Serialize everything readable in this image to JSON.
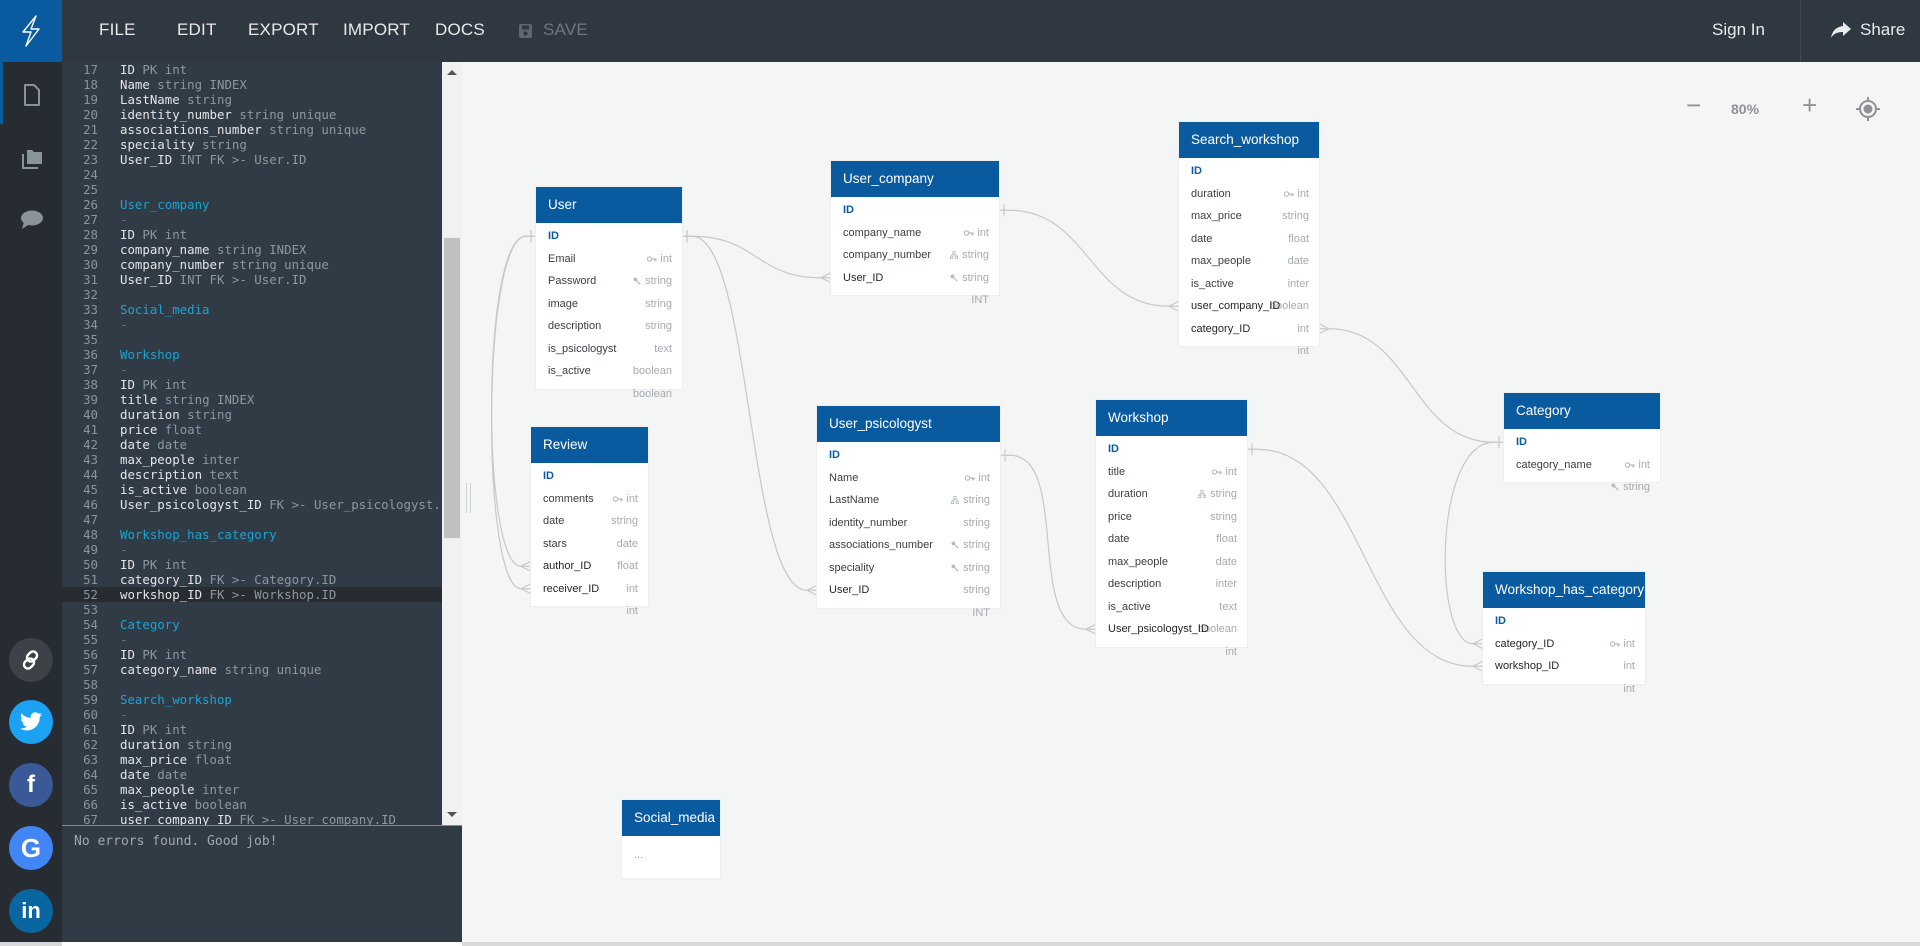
{
  "nav": {
    "menu": [
      "FILE",
      "EDIT",
      "EXPORT",
      "IMPORT",
      "DOCS"
    ],
    "save_label": "SAVE",
    "sign_in": "Sign In",
    "share": "Share"
  },
  "rail": {
    "icons": [
      "document-icon",
      "folders-icon",
      "chat-icon"
    ],
    "social": [
      {
        "name": "link",
        "color": "#3d4248"
      },
      {
        "name": "twitter",
        "color": "#1da1f2"
      },
      {
        "name": "facebook",
        "color": "#3b5998"
      },
      {
        "name": "google",
        "color": "#4285f4"
      },
      {
        "name": "linkedin",
        "color": "#0a66a0"
      }
    ]
  },
  "editor": {
    "active_line": 52,
    "lines": [
      {
        "n": 17,
        "name": "ID",
        "rest": " PK int"
      },
      {
        "n": 18,
        "name": "Name",
        "rest": " string INDEX"
      },
      {
        "n": 19,
        "name": "LastName",
        "rest": " string"
      },
      {
        "n": 20,
        "name": "identity_number",
        "rest": " string unique"
      },
      {
        "n": 21,
        "name": "associations_number",
        "rest": " string unique"
      },
      {
        "n": 22,
        "name": "speciality",
        "rest": " string"
      },
      {
        "n": 23,
        "name": "User_ID",
        "rest": " INT FK >- User.ID"
      },
      {
        "n": 24
      },
      {
        "n": 25
      },
      {
        "n": 26,
        "table": "User_company"
      },
      {
        "n": 27,
        "dash": "-"
      },
      {
        "n": 28,
        "name": "ID",
        "rest": " PK int"
      },
      {
        "n": 29,
        "name": "company_name",
        "rest": " string INDEX"
      },
      {
        "n": 30,
        "name": "company_number",
        "rest": " string unique"
      },
      {
        "n": 31,
        "name": "User_ID",
        "rest": " INT FK >- User.ID"
      },
      {
        "n": 32
      },
      {
        "n": 33,
        "table": "Social_media"
      },
      {
        "n": 34,
        "dash": "-"
      },
      {
        "n": 35
      },
      {
        "n": 36,
        "table": "Workshop"
      },
      {
        "n": 37,
        "dash": "-"
      },
      {
        "n": 38,
        "name": "ID",
        "rest": " PK int"
      },
      {
        "n": 39,
        "name": "title",
        "rest": " string INDEX"
      },
      {
        "n": 40,
        "name": "duration",
        "rest": " string"
      },
      {
        "n": 41,
        "name": "price",
        "rest": " float"
      },
      {
        "n": 42,
        "name": "date",
        "rest": " date"
      },
      {
        "n": 43,
        "name": "max_people",
        "rest": " inter"
      },
      {
        "n": 44,
        "name": "description",
        "rest": " text"
      },
      {
        "n": 45,
        "name": "is_active",
        "rest": " boolean"
      },
      {
        "n": 46,
        "name": "User_psicologyst_ID",
        "rest": " FK >- User_psicologyst.ID"
      },
      {
        "n": 47
      },
      {
        "n": 48,
        "table": "Workshop_has_category"
      },
      {
        "n": 49,
        "dash": "-"
      },
      {
        "n": 50,
        "name": "ID",
        "rest": " PK int"
      },
      {
        "n": 51,
        "name": "category_ID",
        "rest": " FK >- Category.ID"
      },
      {
        "n": 52,
        "name": "workshop_ID",
        "rest": " FK >- Workshop.ID"
      },
      {
        "n": 53
      },
      {
        "n": 54,
        "table": "Category"
      },
      {
        "n": 55,
        "dash": "-"
      },
      {
        "n": 56,
        "name": "ID",
        "rest": " PK int"
      },
      {
        "n": 57,
        "name": "category_name",
        "rest": " string unique"
      },
      {
        "n": 58
      },
      {
        "n": 59,
        "table": "Search_workshop"
      },
      {
        "n": 60,
        "dash": "-"
      },
      {
        "n": 61,
        "name": "ID",
        "rest": " PK int"
      },
      {
        "n": 62,
        "name": "duration",
        "rest": " string"
      },
      {
        "n": 63,
        "name": "max_price",
        "rest": " float"
      },
      {
        "n": 64,
        "name": "date",
        "rest": " date"
      },
      {
        "n": 65,
        "name": "max_people",
        "rest": " inter"
      },
      {
        "n": 66,
        "name": "is_active",
        "rest": " boolean"
      },
      {
        "n": 67,
        "name": "user_company_ID",
        "rest": " FK >- User_company.ID"
      }
    ],
    "status": "No errors found. Good job!"
  },
  "canvas": {
    "zoom_level": "80%",
    "tables": [
      {
        "id": "User",
        "title": "User",
        "fields": [
          {
            "name": "ID",
            "type": "int",
            "kind": "pk",
            "icon": "key"
          },
          {
            "name": "Email",
            "type": "string",
            "icon": "unique"
          },
          {
            "name": "Password",
            "type": "string"
          },
          {
            "name": "image",
            "type": "string"
          },
          {
            "name": "description",
            "type": "text"
          },
          {
            "name": "is_psicologyst",
            "type": "boolean"
          },
          {
            "name": "is_active",
            "type": "boolean"
          }
        ]
      },
      {
        "id": "User_company",
        "title": "User_company",
        "fields": [
          {
            "name": "ID",
            "type": "int",
            "kind": "pk",
            "icon": "key"
          },
          {
            "name": "company_name",
            "type": "string",
            "icon": "index"
          },
          {
            "name": "company_number",
            "type": "string",
            "icon": "unique"
          },
          {
            "name": "User_ID",
            "type": "INT",
            "kind": "fk"
          }
        ]
      },
      {
        "id": "Search_workshop",
        "title": "Search_workshop",
        "fields": [
          {
            "name": "ID",
            "type": "int",
            "kind": "pk",
            "icon": "key"
          },
          {
            "name": "duration",
            "type": "string"
          },
          {
            "name": "max_price",
            "type": "float"
          },
          {
            "name": "date",
            "type": "date"
          },
          {
            "name": "max_people",
            "type": "inter"
          },
          {
            "name": "is_active",
            "type": "boolean"
          },
          {
            "name": "user_company_ID",
            "type": "int",
            "kind": "fk"
          },
          {
            "name": "category_ID",
            "type": "int",
            "kind": "fk"
          }
        ]
      },
      {
        "id": "Review",
        "title": "Review",
        "fields": [
          {
            "name": "ID",
            "type": "int",
            "kind": "pk",
            "icon": "key"
          },
          {
            "name": "comments",
            "type": "string"
          },
          {
            "name": "date",
            "type": "date"
          },
          {
            "name": "stars",
            "type": "float"
          },
          {
            "name": "author_ID",
            "type": "int",
            "kind": "fk"
          },
          {
            "name": "receiver_ID",
            "type": "int",
            "kind": "fk"
          }
        ]
      },
      {
        "id": "User_psicologyst",
        "title": "User_psicologyst",
        "fields": [
          {
            "name": "ID",
            "type": "int",
            "kind": "pk",
            "icon": "key"
          },
          {
            "name": "Name",
            "type": "string",
            "icon": "index"
          },
          {
            "name": "LastName",
            "type": "string"
          },
          {
            "name": "identity_number",
            "type": "string",
            "icon": "unique"
          },
          {
            "name": "associations_number",
            "type": "string",
            "icon": "unique"
          },
          {
            "name": "speciality",
            "type": "string"
          },
          {
            "name": "User_ID",
            "type": "INT",
            "kind": "fk"
          }
        ]
      },
      {
        "id": "Workshop",
        "title": "Workshop",
        "fields": [
          {
            "name": "ID",
            "type": "int",
            "kind": "pk",
            "icon": "key"
          },
          {
            "name": "title",
            "type": "string",
            "icon": "index"
          },
          {
            "name": "duration",
            "type": "string"
          },
          {
            "name": "price",
            "type": "float"
          },
          {
            "name": "date",
            "type": "date"
          },
          {
            "name": "max_people",
            "type": "inter"
          },
          {
            "name": "description",
            "type": "text"
          },
          {
            "name": "is_active",
            "type": "boolean"
          },
          {
            "name": "User_psicologyst_ID",
            "type": "int",
            "kind": "fk"
          }
        ]
      },
      {
        "id": "Category",
        "title": "Category",
        "fields": [
          {
            "name": "ID",
            "type": "int",
            "kind": "pk",
            "icon": "key"
          },
          {
            "name": "category_name",
            "type": "string",
            "icon": "unique"
          }
        ]
      },
      {
        "id": "Workshop_has_category",
        "title": "Workshop_has_category",
        "fields": [
          {
            "name": "ID",
            "type": "int",
            "kind": "pk",
            "icon": "key"
          },
          {
            "name": "category_ID",
            "type": "int",
            "kind": "fk"
          },
          {
            "name": "workshop_ID",
            "type": "int",
            "kind": "fk"
          }
        ]
      },
      {
        "id": "Social_media",
        "title": "Social_media",
        "fields": [],
        "placeholder": "..."
      }
    ],
    "relations": [
      {
        "from": "User_company.User_ID",
        "to": "User.ID"
      },
      {
        "from": "User_psicologyst.User_ID",
        "to": "User.ID"
      },
      {
        "from": "Review.author_ID",
        "to": "User.ID"
      },
      {
        "from": "Review.receiver_ID",
        "to": "User.ID"
      },
      {
        "from": "Search_workshop.user_company_ID",
        "to": "User_company.ID"
      },
      {
        "from": "Search_workshop.category_ID",
        "to": "Category.ID"
      },
      {
        "from": "Workshop.User_psicologyst_ID",
        "to": "User_psicologyst.ID"
      },
      {
        "from": "Workshop_has_category.category_ID",
        "to": "Category.ID"
      },
      {
        "from": "Workshop_has_category.workshop_ID",
        "to": "Workshop.ID"
      }
    ]
  }
}
